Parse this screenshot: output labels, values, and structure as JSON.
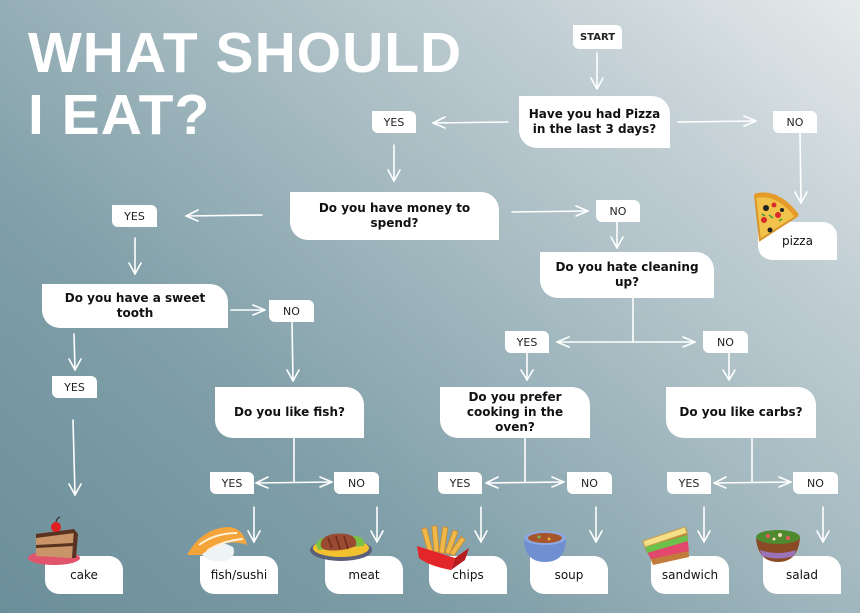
{
  "title": {
    "line1": "WHAT SHOULD",
    "line2": "I EAT?"
  },
  "start": "START",
  "questions": {
    "pizza": "Have you had Pizza in the last 3 days?",
    "money": "Do you have money to spend?",
    "sweet": "Do you have a sweet tooth",
    "cleaning": "Do you hate cleaning up?",
    "fish": "Do you like fish?",
    "oven": "Do you prefer cooking in the oven?",
    "carbs": "Do you like carbs?"
  },
  "answers": {
    "yes": "YES",
    "no": "NO"
  },
  "results": {
    "pizza": "pizza",
    "cake": "cake",
    "fish": "fish/sushi",
    "meat": "meat",
    "chips": "chips",
    "soup": "soup",
    "sandwich": "sandwich",
    "salad": "salad"
  },
  "icons": [
    "pizza-icon",
    "cake-icon",
    "sushi-icon",
    "steak-icon",
    "fries-icon",
    "soup-icon",
    "sandwich-icon",
    "salad-icon"
  ]
}
